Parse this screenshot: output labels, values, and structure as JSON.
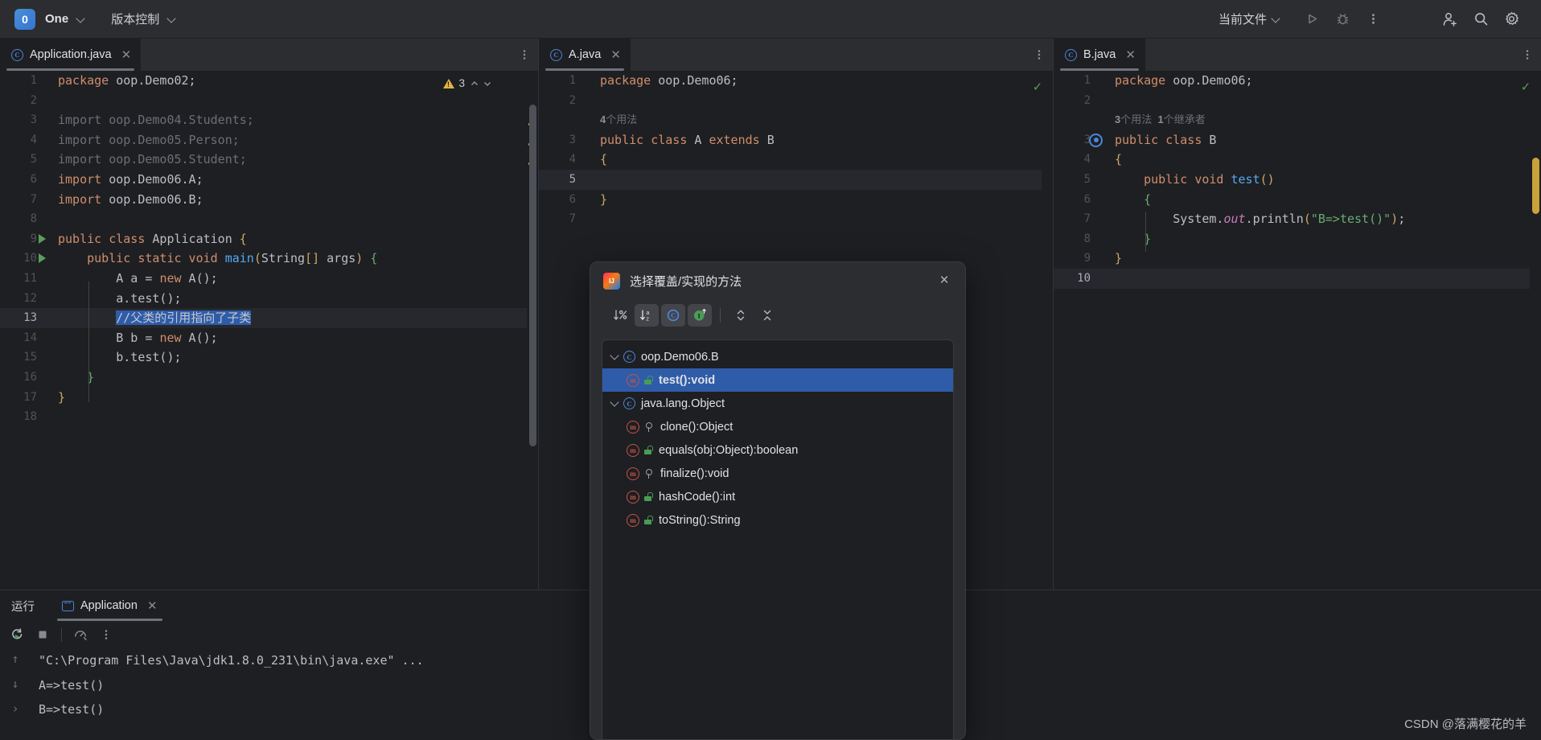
{
  "topbar": {
    "project_badge": "0",
    "project_name": "One",
    "vcs_label": "版本控制",
    "current_file": "当前文件",
    "icons": {
      "run": "run-icon",
      "debug": "debug-icon",
      "more": "more-vertical-icon",
      "add_user": "add-user-icon",
      "search": "search-icon",
      "settings": "gear-icon"
    }
  },
  "editors": [
    {
      "tab": "Application.java",
      "warn_count": "3",
      "lines": [
        {
          "n": "1"
        },
        {
          "n": "2"
        },
        {
          "n": "3"
        },
        {
          "n": "4"
        },
        {
          "n": "5"
        },
        {
          "n": "6"
        },
        {
          "n": "7"
        },
        {
          "n": "8"
        },
        {
          "n": "9"
        },
        {
          "n": "10"
        },
        {
          "n": "11"
        },
        {
          "n": "12"
        },
        {
          "n": "13"
        },
        {
          "n": "14"
        },
        {
          "n": "15"
        },
        {
          "n": "16"
        },
        {
          "n": "17"
        },
        {
          "n": "18"
        }
      ],
      "code": {
        "l1_kw": "package",
        "l1_rest": " oop.Demo02;",
        "l3": "import oop.Demo04.Students;",
        "l4": "import oop.Demo05.Person;",
        "l5": "import oop.Demo05.Student;",
        "l6_kw": "import",
        "l6_rest": " oop.Demo06.A;",
        "l7_kw": "import",
        "l7_rest": " oop.Demo06.B;",
        "l9_kw": "public class",
        "l9_name": " Application ",
        "l9_br": "{",
        "l10_kw": "public static void",
        "l10_fn": " main",
        "l10_p1": "(",
        "l10_t": "String",
        "l10_b": "[]",
        "l10_arg": " args",
        "l10_p2": ")",
        "l10_br": " {",
        "l11": "A a = ",
        "l11_kw": "new",
        "l11_b": " A();",
        "l12": "a.test();",
        "l13_comment": "//父类的引用指向了子类",
        "l14": "B b = ",
        "l14_kw": "new",
        "l14_b": " A();",
        "l15": "b.test();",
        "l16": "}",
        "l17": "}"
      }
    },
    {
      "tab": "A.java",
      "lines": [
        {
          "n": "1"
        },
        {
          "n": "2"
        },
        {
          "n": "3"
        },
        {
          "n": "4"
        },
        {
          "n": "5"
        },
        {
          "n": "6"
        },
        {
          "n": "7"
        }
      ],
      "code": {
        "l1_kw": "package",
        "l1_rest": " oop.Demo06;",
        "inlay_usages_num": "4",
        "inlay_usages_text": "个用法",
        "l3_kw": "public class",
        "l3_name": " A ",
        "l3_ext": "extends",
        "l3_sup": " B",
        "l4": "{",
        "l6": "}"
      }
    },
    {
      "tab": "B.java",
      "lines": [
        {
          "n": "1"
        },
        {
          "n": "2"
        },
        {
          "n": "3"
        },
        {
          "n": "4"
        },
        {
          "n": "5"
        },
        {
          "n": "6"
        },
        {
          "n": "7"
        },
        {
          "n": "8"
        },
        {
          "n": "9"
        },
        {
          "n": "10"
        }
      ],
      "code": {
        "l1_kw": "package",
        "l1_rest": " oop.Demo06;",
        "inlay_usages_num": "3",
        "inlay_usages_text": "个用法",
        "inlay_impl_num": "1",
        "inlay_impl_text": "个继承者",
        "l3_kw": "public class",
        "l3_name": " B",
        "l4": "{",
        "l5_kw": "public void",
        "l5_fn": " test",
        "l5_b": "()",
        "l6": "{",
        "l7_a": "System.",
        "l7_f": "out",
        "l7_b": ".",
        "l7_fn": "println",
        "l7_p1": "(",
        "l7_s": "\"B=>test()\"",
        "l7_p2": ")",
        "l7_sc": ";",
        "l8": "}",
        "l9": "}"
      }
    }
  ],
  "dialog": {
    "title": "选择覆盖/实现的方法",
    "close": "×",
    "toolbar": [
      {
        "name": "sort-by-visibility-button",
        "glyph": "↓%",
        "active": false
      },
      {
        "name": "sort-alphabetically-button",
        "glyph": "↓az",
        "active": true
      },
      {
        "name": "show-classes-button",
        "glyph": "C",
        "active": true
      },
      {
        "name": "show-interfaces-button",
        "glyph": "I",
        "active": true
      },
      {
        "name": "expand-all-button",
        "glyph": "expand",
        "active": false
      },
      {
        "name": "collapse-all-button",
        "glyph": "collapse",
        "active": false
      }
    ],
    "tree": [
      {
        "type": "class",
        "label": "oop.Demo06.B",
        "selected": false
      },
      {
        "type": "method",
        "label": "test():void",
        "vis": "public",
        "selected": true
      },
      {
        "type": "class",
        "label": "java.lang.Object",
        "selected": false
      },
      {
        "type": "method",
        "label": "clone():Object",
        "vis": "protected",
        "selected": false
      },
      {
        "type": "method",
        "label": "equals(obj:Object):boolean",
        "vis": "public",
        "selected": false
      },
      {
        "type": "method",
        "label": "finalize():void",
        "vis": "protected",
        "selected": false
      },
      {
        "type": "method",
        "label": "hashCode():int",
        "vis": "public",
        "selected": false
      },
      {
        "type": "method",
        "label": "toString():String",
        "vis": "public",
        "selected": false
      }
    ]
  },
  "runpanel": {
    "label": "运行",
    "tab": "Application",
    "buttons": [
      "rerun-icon",
      "stop-icon",
      "profiler-icon",
      "more-vertical-icon"
    ],
    "console": [
      "\"C:\\Program Files\\Java\\jdk1.8.0_231\\bin\\java.exe\" ...",
      "A=>test()",
      "B=>test()"
    ]
  },
  "watermark": "CSDN @落满樱花的羊",
  "colors": {
    "accent_blue": "#3574d4",
    "selection_blue": "#2f5ca8",
    "keyword_orange": "#cf8e6d",
    "string_green": "#6aab73",
    "warning_yellow": "#e3b341",
    "ok_green": "#5a9e5a",
    "method_red": "#c2544b",
    "bg_editor": "#1e1f22",
    "bg_chrome": "#2b2d30"
  }
}
